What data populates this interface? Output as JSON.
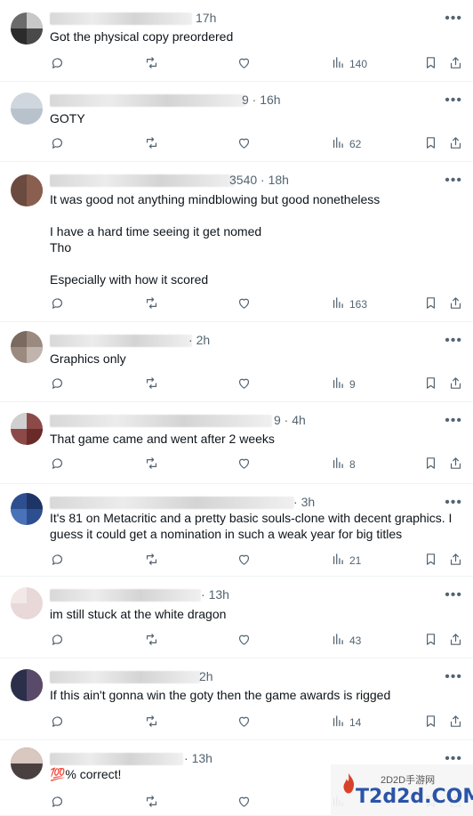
{
  "icons": {
    "reply": "speech-bubble-icon",
    "retweet": "repost-icon",
    "like": "heart-icon",
    "views": "bar-chart-icon",
    "bookmark": "bookmark-icon",
    "share": "share-icon",
    "more": "ellipsis-icon"
  },
  "more_label": "•••",
  "replies": [
    {
      "handle_tail": "",
      "time": "17h",
      "text": "Got the physical copy preordered",
      "views": "140"
    },
    {
      "handle_tail": "9 · ",
      "time": "16h",
      "text": "GOTY",
      "views": "62"
    },
    {
      "handle_tail": "3540 · ",
      "time": "18h",
      "text": "It was good not anything mindblowing but good nonetheless\n\nI have a hard time seeing it get nomed\nTho\n\nEspecially with how it scored",
      "views": "163"
    },
    {
      "handle_tail": "· ",
      "time": "2h",
      "text": "Graphics only",
      "views": "9"
    },
    {
      "handle_tail": "9 · ",
      "time": "4h",
      "text": "That game came and went after 2 weeks",
      "views": "8"
    },
    {
      "handle_tail": "· ",
      "time": "3h",
      "text": "It's 81 on Metacritic and a pretty basic souls-clone with decent graphics. I guess it could get a nomination in such a weak year for big titles",
      "views": "21"
    },
    {
      "handle_tail": "· ",
      "time": "13h",
      "text": "im still stuck at the white dragon",
      "views": "43"
    },
    {
      "handle_tail": "",
      "time": "2h",
      "text": "If this ain't gonna win the goty then the game awards is rigged",
      "views": "14"
    },
    {
      "handle_tail": "· ",
      "time": "13h",
      "text": "💯% correct!",
      "views": ""
    }
  ],
  "watermark": {
    "top": "2D2D手游网",
    "main": "T2d2d.COM"
  },
  "colors": {
    "text": "#0f1419",
    "secondary": "#536471",
    "divider": "#eff3f4",
    "watermark_blue": "#2a54a8",
    "watermark_red": "#d9412b"
  }
}
